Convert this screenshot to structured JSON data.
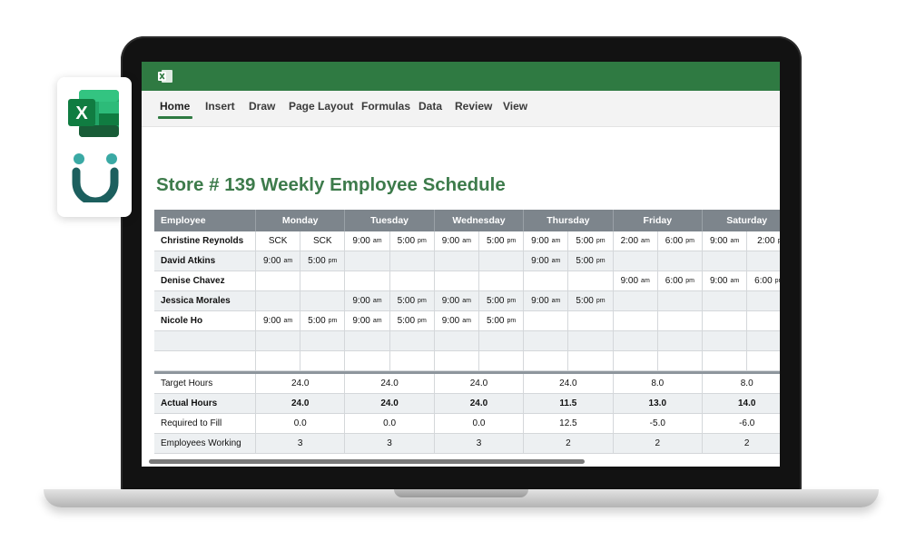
{
  "app": {
    "menu_tabs": [
      "Home",
      "Insert",
      "Draw",
      "Page Layout",
      "Formulas",
      "Data",
      "Review",
      "View"
    ],
    "active_tab": "Home",
    "accent_color": "#2f7a42"
  },
  "sheet": {
    "title": "Store # 139 Weekly Employee Schedule",
    "header": {
      "employee": "Employee",
      "days": [
        "Monday",
        "Tuesday",
        "Wednesday",
        "Thursday",
        "Friday",
        "Saturday"
      ]
    },
    "rows": [
      {
        "name": "Christine Reynolds",
        "shifts": [
          [
            "SCK",
            ""
          ],
          [
            "SCK",
            ""
          ],
          [
            "9:00",
            "am"
          ],
          [
            "5:00",
            "pm"
          ],
          [
            "9:00",
            "am"
          ],
          [
            "5:00",
            "pm"
          ],
          [
            "9:00",
            "am"
          ],
          [
            "5:00",
            "pm"
          ],
          [
            "2:00",
            "am"
          ],
          [
            "6:00",
            "pm"
          ],
          [
            "9:00",
            "am"
          ],
          [
            "2:00",
            "p"
          ]
        ]
      },
      {
        "name": "David Atkins",
        "shifts": [
          [
            "9:00",
            "am"
          ],
          [
            "5:00",
            "pm"
          ],
          [
            "",
            ""
          ],
          [
            "",
            ""
          ],
          [
            "",
            ""
          ],
          [
            "",
            ""
          ],
          [
            "9:00",
            "am"
          ],
          [
            "5:00",
            "pm"
          ],
          [
            "",
            ""
          ],
          [
            "",
            ""
          ],
          [
            "",
            ""
          ],
          [
            "",
            ""
          ]
        ]
      },
      {
        "name": "Denise Chavez",
        "shifts": [
          [
            "",
            ""
          ],
          [
            "",
            ""
          ],
          [
            "",
            ""
          ],
          [
            "",
            ""
          ],
          [
            "",
            ""
          ],
          [
            "",
            ""
          ],
          [
            "",
            ""
          ],
          [
            "",
            ""
          ],
          [
            "9:00",
            "am"
          ],
          [
            "6:00",
            "pm"
          ],
          [
            "9:00",
            "am"
          ],
          [
            "6:00",
            "pm"
          ]
        ]
      },
      {
        "name": "Jessica Morales",
        "shifts": [
          [
            "",
            ""
          ],
          [
            "",
            ""
          ],
          [
            "9:00",
            "am"
          ],
          [
            "5:00",
            "pm"
          ],
          [
            "9:00",
            "am"
          ],
          [
            "5:00",
            "pm"
          ],
          [
            "9:00",
            "am"
          ],
          [
            "5:00",
            "pm"
          ],
          [
            "",
            ""
          ],
          [
            "",
            ""
          ],
          [
            "",
            ""
          ],
          [
            "",
            ""
          ]
        ]
      },
      {
        "name": "Nicole Ho",
        "shifts": [
          [
            "9:00",
            "am"
          ],
          [
            "5:00",
            "pm"
          ],
          [
            "9:00",
            "am"
          ],
          [
            "5:00",
            "pm"
          ],
          [
            "9:00",
            "am"
          ],
          [
            "5:00",
            "pm"
          ],
          [
            "",
            ""
          ],
          [
            "",
            ""
          ],
          [
            "",
            ""
          ],
          [
            "",
            ""
          ],
          [
            "",
            ""
          ],
          [
            "",
            ""
          ]
        ]
      },
      {
        "name": "",
        "shifts": [
          [
            "",
            ""
          ],
          [
            "",
            ""
          ],
          [
            "",
            ""
          ],
          [
            "",
            ""
          ],
          [
            "",
            ""
          ],
          [
            "",
            ""
          ],
          [
            "",
            ""
          ],
          [
            "",
            ""
          ],
          [
            "",
            ""
          ],
          [
            "",
            ""
          ],
          [
            "",
            ""
          ],
          [
            "",
            ""
          ]
        ]
      },
      {
        "name": "",
        "shifts": [
          [
            "",
            ""
          ],
          [
            "",
            ""
          ],
          [
            "",
            ""
          ],
          [
            "",
            ""
          ],
          [
            "",
            ""
          ],
          [
            "",
            ""
          ],
          [
            "",
            ""
          ],
          [
            "",
            ""
          ],
          [
            "",
            ""
          ],
          [
            "",
            ""
          ],
          [
            "",
            ""
          ],
          [
            "",
            ""
          ]
        ]
      }
    ],
    "summary": [
      {
        "label": "Target Hours",
        "bold": false,
        "values": [
          "24.0",
          "24.0",
          "24.0",
          "24.0",
          "8.0",
          "8.0"
        ]
      },
      {
        "label": "Actual Hours",
        "bold": true,
        "values": [
          "24.0",
          "24.0",
          "24.0",
          "11.5",
          "13.0",
          "14.0"
        ]
      },
      {
        "label": "Required to Fill",
        "bold": false,
        "values": [
          "0.0",
          "0.0",
          "0.0",
          "12.5",
          "-5.0",
          "-6.0"
        ]
      },
      {
        "label": "Employees Working",
        "bold": false,
        "values": [
          "3",
          "3",
          "3",
          "2",
          "2",
          "2"
        ]
      }
    ]
  },
  "icons": {
    "excel_letter": "X",
    "brand_colors": {
      "excel_dark": "#185c37",
      "excel_mid": "#21a366",
      "excel_light": "#33c481",
      "smile": "#1c5f5e",
      "dots": "#3aa9a4"
    }
  }
}
